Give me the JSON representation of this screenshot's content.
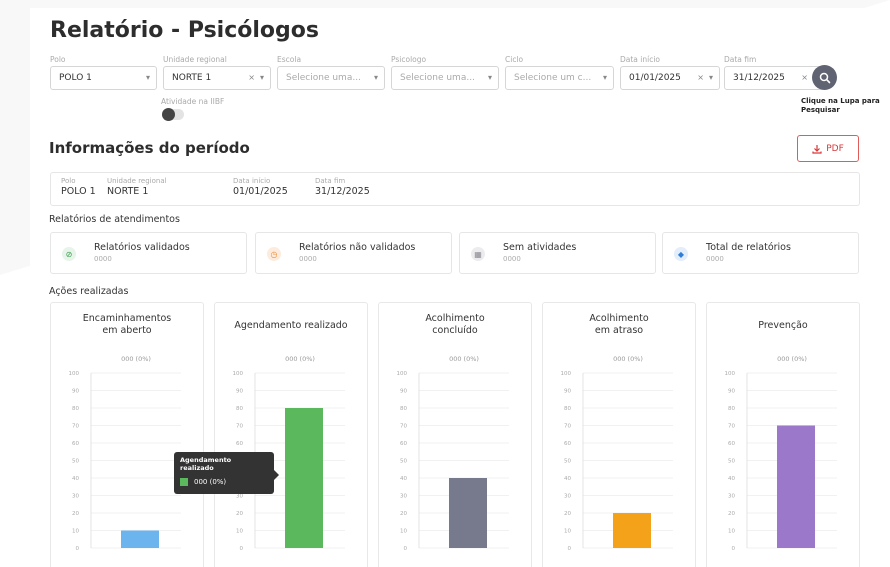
{
  "title": "Relatório - Psicólogos",
  "filters": [
    {
      "label": "Polo",
      "value": "POLO 1",
      "placeholder": false,
      "clearable": false
    },
    {
      "label": "Unidade regional",
      "value": "NORTE 1",
      "placeholder": false,
      "clearable": true
    },
    {
      "label": "Escola",
      "value": "Selecione uma...",
      "placeholder": true,
      "clearable": false
    },
    {
      "label": "Psicologo",
      "value": "Selecione uma...",
      "placeholder": true,
      "clearable": false
    },
    {
      "label": "Ciclo",
      "value": "Selecione um c...",
      "placeholder": true,
      "clearable": false
    },
    {
      "label": "Data início",
      "value": "01/01/2025",
      "placeholder": false,
      "clearable": true
    },
    {
      "label": "Data fim",
      "value": "31/12/2025",
      "placeholder": false,
      "clearable": true
    }
  ],
  "clear_glyph": "×",
  "dropdown_glyph": "▾",
  "toggle": {
    "label": "Atividade na IIBF",
    "on": false
  },
  "search": {
    "hint": "Clique na Lupa para Pesquisar",
    "icon": "magnifier-icon"
  },
  "period": {
    "title": "Informações do período",
    "pdf_label": "PDF",
    "items": [
      {
        "label": "Polo",
        "value": "POLO 1"
      },
      {
        "label": "Unidade regional",
        "value": "NORTE 1"
      },
      {
        "label": "Data início",
        "value": "01/01/2025"
      },
      {
        "label": "Data fim",
        "value": "31/12/2025"
      }
    ]
  },
  "reports": {
    "title": "Relatórios de atendimentos",
    "cards": [
      {
        "label": "Relatórios validados",
        "count": "0000",
        "icon": "check-icon",
        "glyph": "⊘",
        "icon_bg": "#e6f4ea",
        "icon_color": "#3c9a4d"
      },
      {
        "label": "Relatórios não validados",
        "count": "0000",
        "icon": "clock-icon",
        "glyph": "◷",
        "icon_bg": "#fdecdd",
        "icon_color": "#e98b3a"
      },
      {
        "label": "Sem atividades",
        "count": "0000",
        "icon": "calendar-icon",
        "glyph": "▦",
        "icon_bg": "#ececee",
        "icon_color": "#8c8c94"
      },
      {
        "label": "Total de relatórios",
        "count": "0000",
        "icon": "layers-icon",
        "glyph": "◆",
        "icon_bg": "#e3eefa",
        "icon_color": "#2f7fd6"
      }
    ]
  },
  "actions": {
    "title": "Ações realizadas"
  },
  "chart_data": [
    {
      "type": "bar",
      "title_lines": [
        "Encaminhamentos",
        "em aberto"
      ],
      "data_label": "000 (0%)",
      "value": 10,
      "ylim": [
        0,
        100
      ],
      "yticks": [
        0,
        10,
        20,
        30,
        40,
        50,
        60,
        70,
        80,
        90,
        100
      ],
      "color": "#6cb4ee"
    },
    {
      "type": "bar",
      "title_lines": [
        "Agendamento realizado"
      ],
      "data_label": "000 (0%)",
      "value": 80,
      "ylim": [
        0,
        100
      ],
      "yticks": [
        0,
        10,
        20,
        30,
        40,
        50,
        60,
        70,
        80,
        90,
        100
      ],
      "color": "#5cb85c"
    },
    {
      "type": "bar",
      "title_lines": [
        "Acolhimento",
        "concluído"
      ],
      "data_label": "000 (0%)",
      "value": 40,
      "ylim": [
        0,
        100
      ],
      "yticks": [
        0,
        10,
        20,
        30,
        40,
        50,
        60,
        70,
        80,
        90,
        100
      ],
      "color": "#777a8c"
    },
    {
      "type": "bar",
      "title_lines": [
        "Acolhimento",
        "em atraso"
      ],
      "data_label": "000 (0%)",
      "value": 20,
      "ylim": [
        0,
        100
      ],
      "yticks": [
        0,
        10,
        20,
        30,
        40,
        50,
        60,
        70,
        80,
        90,
        100
      ],
      "color": "#f5a21b"
    },
    {
      "type": "bar",
      "title_lines": [
        "Prevenção"
      ],
      "data_label": "000 (0%)",
      "value": 70,
      "ylim": [
        0,
        100
      ],
      "yticks": [
        0,
        10,
        20,
        30,
        40,
        50,
        60,
        70,
        80,
        90,
        100
      ],
      "color": "#9b78c9"
    }
  ],
  "tooltip": {
    "title_line1": "Agendamento",
    "title_line2": "realizado",
    "value": "000 (0%)"
  }
}
